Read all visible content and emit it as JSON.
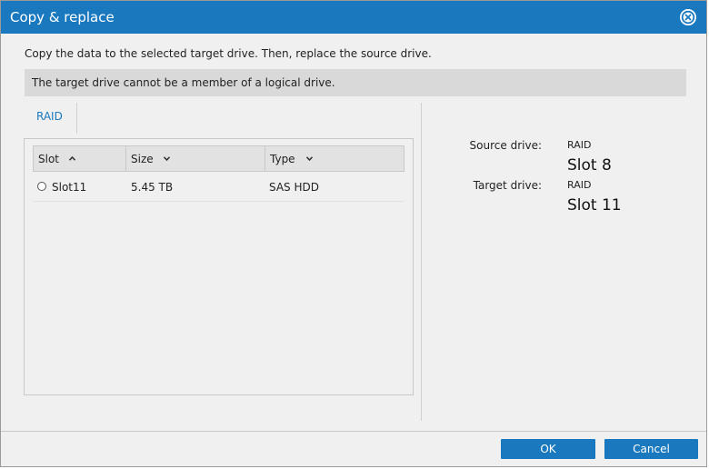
{
  "dialog": {
    "title": "Copy & replace",
    "intro": "Copy the data to the selected target drive. Then, replace the source drive.",
    "warning": "The target drive cannot be a member of a logical drive."
  },
  "tabs": [
    {
      "label": "RAID"
    }
  ],
  "table": {
    "columns": [
      {
        "label": "Slot",
        "sort": "ascending"
      },
      {
        "label": "Size",
        "sort": "descending"
      },
      {
        "label": "Type",
        "sort": "descending"
      }
    ],
    "rows": [
      {
        "slot": "Slot11",
        "size": "5.45 TB",
        "type": "SAS HDD",
        "selected": false
      }
    ]
  },
  "summary": {
    "source_label": "Source drive:",
    "source_group": "RAID",
    "source_slot": "Slot 8",
    "target_label": "Target drive:",
    "target_group": "RAID",
    "target_slot": "Slot 11"
  },
  "buttons": {
    "ok": "OK",
    "cancel": "Cancel"
  },
  "colors": {
    "accent": "#1a79be",
    "background": "#f0f0f0",
    "warning_bg": "#d9d9d9",
    "header_bg": "#e2e2e2"
  },
  "icons": {
    "close": "close-circle-icon",
    "sort_ascending": "chevron-up-icon",
    "sort_descending": "chevron-down-icon",
    "radio": "radio-unchecked-icon"
  }
}
